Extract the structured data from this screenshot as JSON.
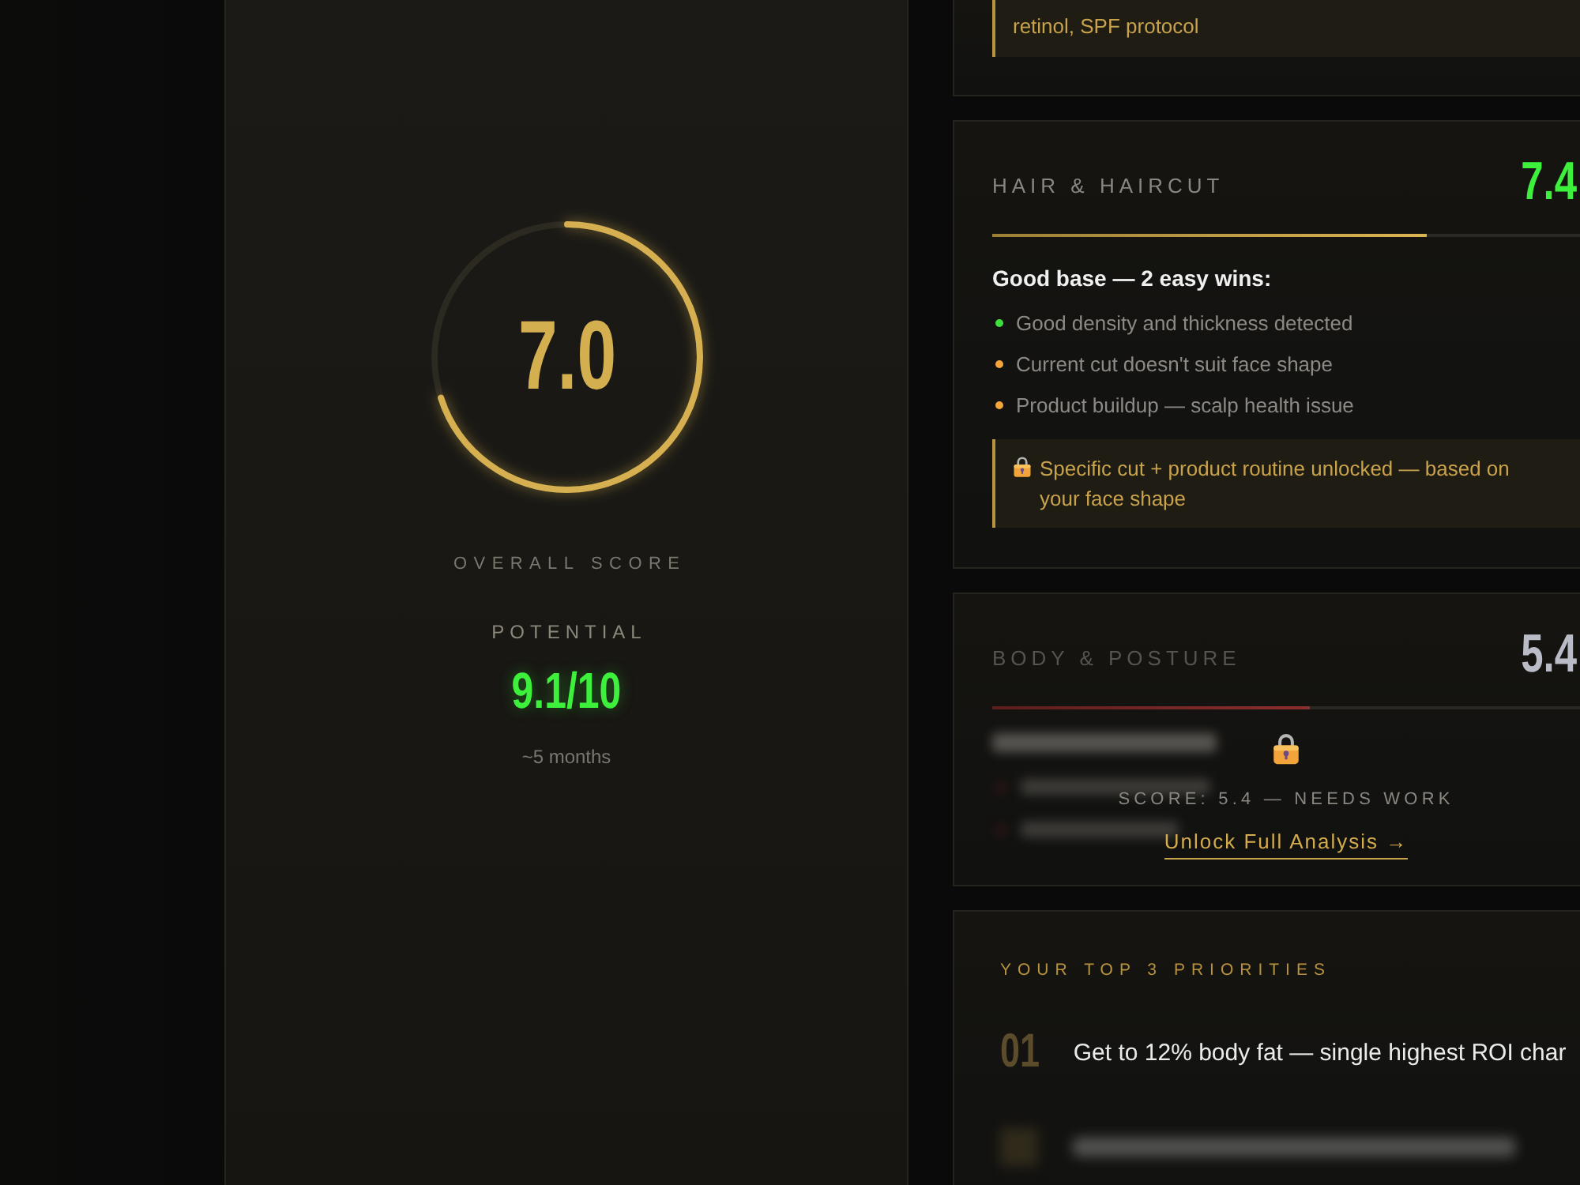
{
  "score_panel": {
    "score": "7.0",
    "level": 0.7,
    "label": "OVERALL SCORE",
    "potential_label": "POTENTIAL",
    "potential": "9.1/10",
    "timeframe": "~5 months"
  },
  "categories": [
    {
      "kind": "note-tail",
      "note": "retinol, SPF protocol"
    },
    {
      "kind": "open",
      "title": "HAIR & HAIRCUT",
      "score": "7.4",
      "color": "#3cf03c",
      "level": 0.74,
      "headline": "Good base — 2 easy wins:",
      "bullets": [
        {
          "text": "Good density and thickness detected",
          "color": "#3ee03e"
        },
        {
          "text": "Current cut doesn't suit face shape",
          "color": "#f5a53a"
        },
        {
          "text": "Product buildup — scalp health issue",
          "color": "#f5a53a"
        }
      ],
      "note": "Specific cut + product routine unlocked — based on your face shape"
    },
    {
      "kind": "locked",
      "title": "BODY & POSTURE",
      "score": "5.4",
      "color": "#b9bcc6",
      "level": 0.54,
      "lock_label": "SCORE: 5.4 — NEEDS WORK",
      "unlock_link": "Unlock Full Analysis →"
    }
  ],
  "priorities": {
    "title": "YOUR TOP 3 PRIORITIES",
    "items": [
      {
        "kind": "text",
        "number": "01",
        "text": "Get to 12% body fat — single highest ROI char"
      },
      {
        "kind": "blurred"
      }
    ]
  }
}
